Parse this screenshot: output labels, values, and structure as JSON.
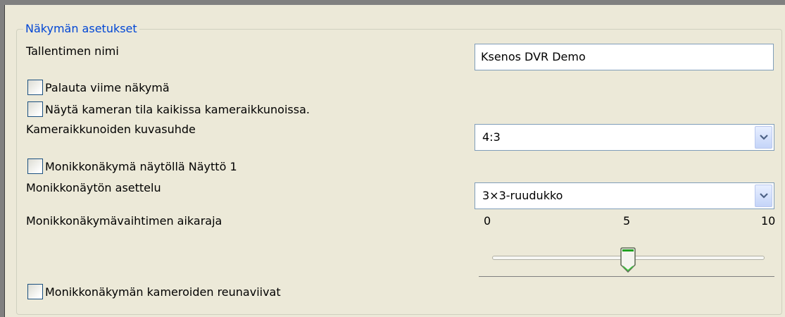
{
  "group": {
    "title": "Näkymän asetukset"
  },
  "recorder_name": {
    "label": "Tallentimen nimi",
    "value": "Ksenos DVR Demo"
  },
  "restore_last_view": {
    "label": "Palauta viime näkymä",
    "checked": false
  },
  "show_camera_status": {
    "label": "Näytä kameran tila kaikissa kameraikkunoissa.",
    "checked": false
  },
  "aspect_ratio": {
    "label": "Kameraikkunoiden kuvasuhde",
    "value": "4:3"
  },
  "multiview_on_display": {
    "label": "Monikkonäkymä näytöllä Näyttö 1",
    "checked": false
  },
  "multiview_layout": {
    "label": "Monikkonäytön asettelu",
    "value": "3×3-ruudukko"
  },
  "switcher_timeout": {
    "label": "Monikkonäkymävaihtimen aikaraja",
    "ticks": [
      "0",
      "5",
      "10"
    ],
    "min": 0,
    "max": 10,
    "value": 5
  },
  "camera_borders": {
    "label": "Monikkonäkymän kameroiden reunaviivat",
    "checked": false
  },
  "colors": {
    "title_blue": "#0046d5",
    "background": "#ece9d8",
    "field_border": "#7f9db9"
  }
}
